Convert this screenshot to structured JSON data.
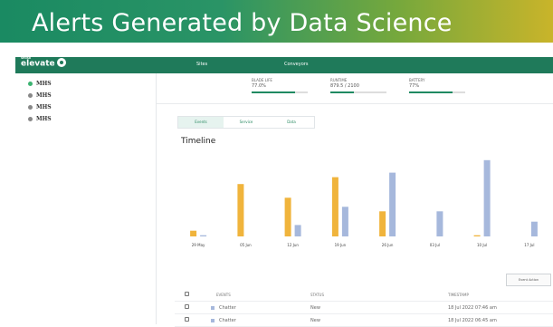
{
  "banner": {
    "title": "Alerts Generated by Data Science"
  },
  "app": {
    "brand": "elevate",
    "brand_small": "SENSR",
    "nav": [
      "Sites",
      "Conveyors"
    ]
  },
  "sidebar": {
    "sites": [
      {
        "label": "MHS",
        "status_color": "#3cb371"
      },
      {
        "label": "MHS",
        "status_color": "#888888"
      },
      {
        "label": "MHS",
        "status_color": "#888888"
      },
      {
        "label": "MHS",
        "status_color": "#888888"
      }
    ]
  },
  "stats": [
    {
      "label": "BLADE LIFE",
      "value": "77.0%",
      "fill": 0.77
    },
    {
      "label": "RUNTIME",
      "value": "879.5 / 2100",
      "fill": 0.42
    },
    {
      "label": "BATTERY",
      "value": "77%",
      "fill": 0.77
    }
  ],
  "tabs": [
    "Events",
    "Service",
    "Data"
  ],
  "timeline": {
    "title": "Timeline"
  },
  "chart_data": {
    "type": "bar",
    "categories": [
      "29 May",
      "05 Jun",
      "12 Jun",
      "19 Jun",
      "26 Jun",
      "03 Jul",
      "10 Jul",
      "17 Jul"
    ],
    "series": [
      {
        "color": "#f0b43c",
        "values": [
          5,
          46,
          34,
          52,
          22,
          0,
          1,
          0
        ]
      },
      {
        "color": "#a6b8dc",
        "values": [
          1,
          0,
          10,
          26,
          56,
          22,
          67,
          13
        ]
      }
    ],
    "ylim": [
      0,
      70
    ],
    "grid": false
  },
  "event_action": {
    "label": "Event Action"
  },
  "table": {
    "columns": [
      "EVENTS",
      "STATUS",
      "TIMESTAMP"
    ],
    "rows": [
      {
        "event": "Chatter",
        "status": "New",
        "timestamp": "18 Jul 2022 07:46 am"
      },
      {
        "event": "Chatter",
        "status": "New",
        "timestamp": "18 Jul 2022 06:45 am"
      }
    ]
  }
}
